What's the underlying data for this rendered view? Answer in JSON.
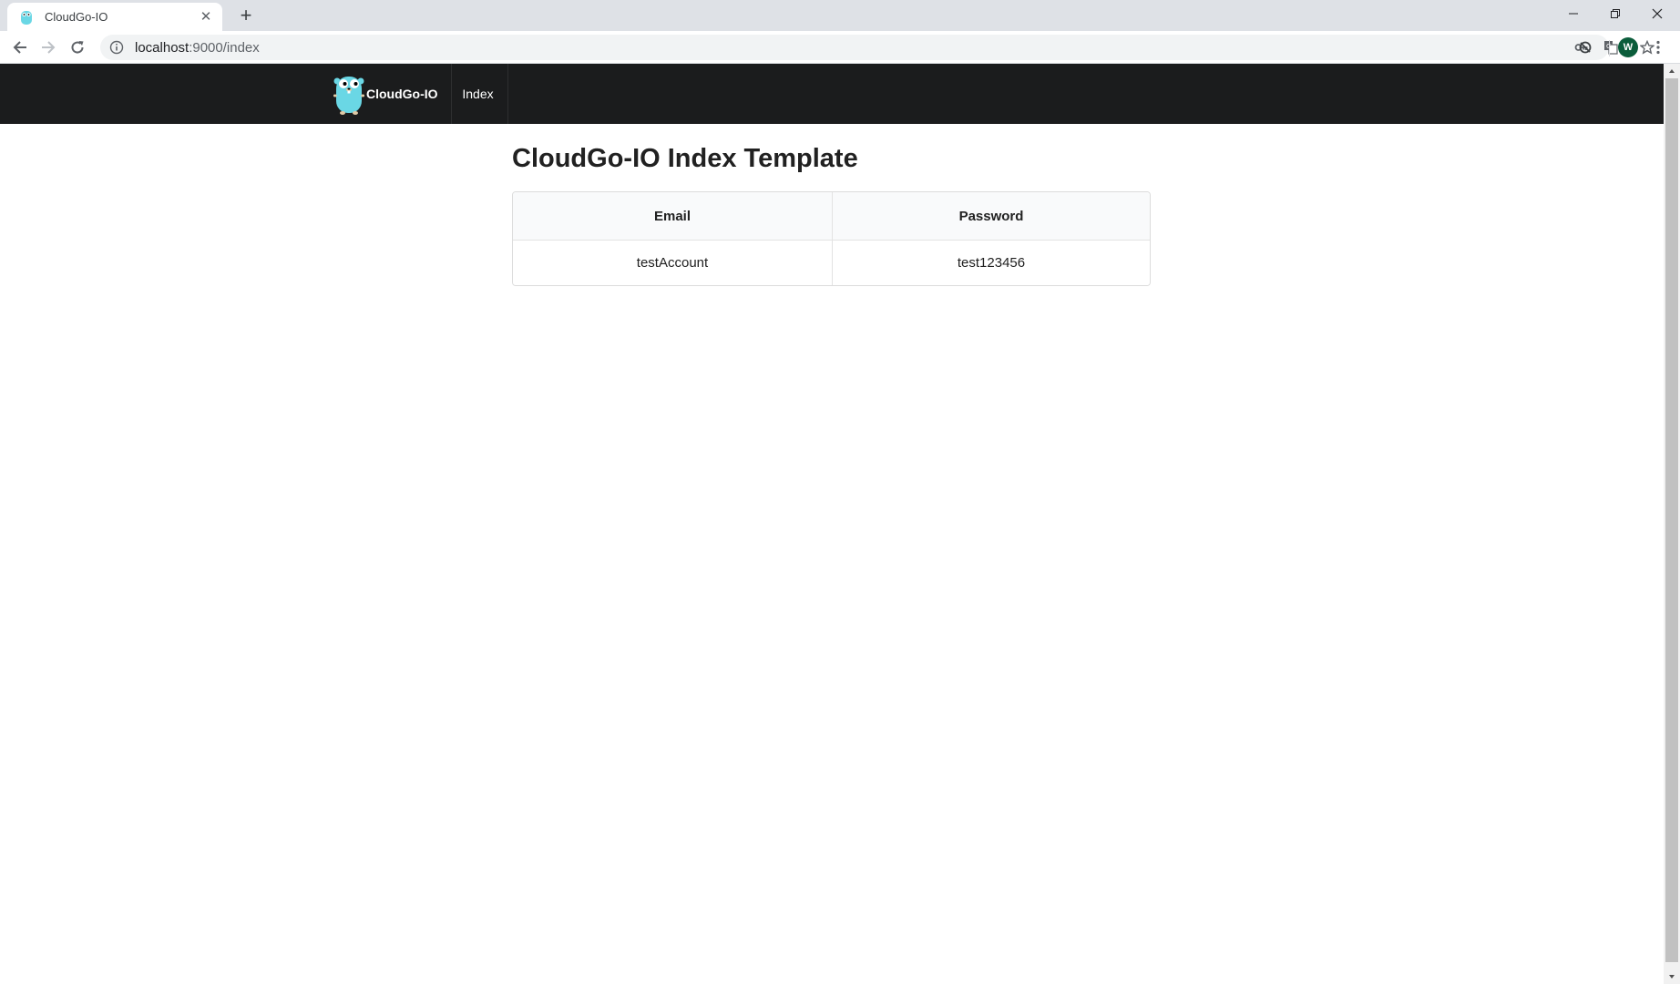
{
  "browser": {
    "tab": {
      "title": "CloudGo-IO",
      "close_glyph": "✕"
    },
    "new_tab_glyph": "+",
    "address": {
      "host": "localhost",
      "path": ":9000/index"
    },
    "profile_initial": "W"
  },
  "navbar": {
    "brand": "CloudGo-IO",
    "items": [
      {
        "label": "Index"
      }
    ],
    "bg_color": "#1b1c1d"
  },
  "page": {
    "title": "CloudGo-IO Index Template",
    "table": {
      "headers": [
        "Email",
        "Password"
      ],
      "rows": [
        [
          "testAccount",
          "test123456"
        ]
      ]
    }
  },
  "colors": {
    "gopher": "#6ad7e5",
    "avatar": "#0b5d3b"
  }
}
